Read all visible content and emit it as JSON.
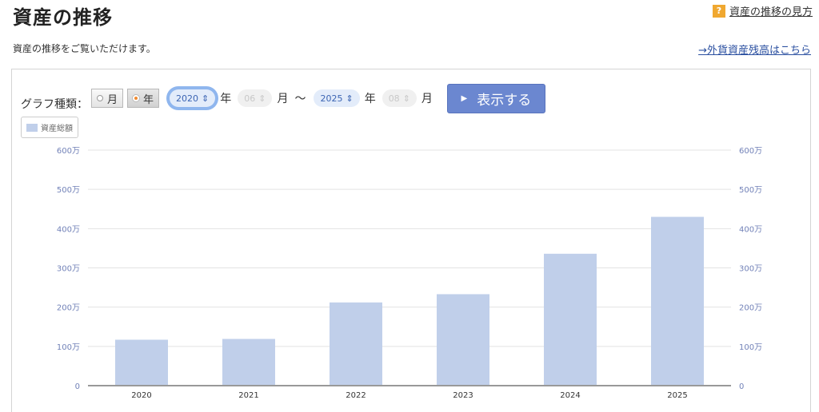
{
  "header": {
    "title": "資産の推移",
    "help_icon": "?",
    "help_link": "資産の推移の見方"
  },
  "subtitle": "資産の推移をご覧いただけます。",
  "fx_link": "→外貨資産残高はこちら",
  "controls": {
    "graph_type_label": "グラフ種類：",
    "options": [
      {
        "label": "月",
        "selected": false
      },
      {
        "label": "年",
        "selected": true
      }
    ],
    "from_year": "2020",
    "from_month": "06",
    "to_year": "2025",
    "to_month": "08",
    "year_unit": "年",
    "month_unit": "月",
    "tilde": "〜",
    "show_button": "表示する"
  },
  "legend": {
    "label": "資産総額",
    "color": "#c0cfea"
  },
  "chart_data": {
    "type": "bar",
    "categories": [
      "2020",
      "2021",
      "2022",
      "2023",
      "2024",
      "2025"
    ],
    "series": [
      {
        "name": "資産総額",
        "values": [
          1170000,
          1190000,
          2120000,
          2330000,
          3360000,
          4300000
        ],
        "color": "#c0cfea"
      }
    ],
    "yticks": [
      "0",
      "100万",
      "200万",
      "300万",
      "400万",
      "500万",
      "600万"
    ],
    "ylim": [
      0,
      6000000
    ],
    "y_axis_both_sides": true,
    "grid": true
  }
}
